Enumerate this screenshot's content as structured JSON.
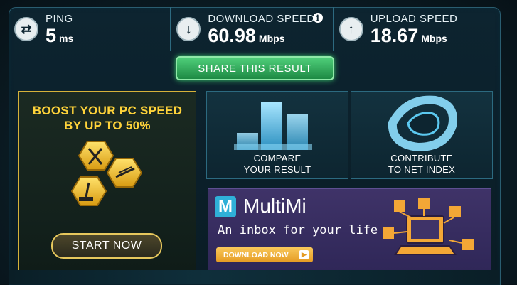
{
  "stats": {
    "ping": {
      "label": "PING",
      "value": "5",
      "unit": "ms",
      "icon": "ping-arrows-icon"
    },
    "download": {
      "label": "DOWNLOAD SPEED",
      "value": "60.98",
      "unit": "Mbps",
      "icon": "download-arrow-icon",
      "info": "i"
    },
    "upload": {
      "label": "UPLOAD SPEED",
      "value": "18.67",
      "unit": "Mbps",
      "icon": "upload-arrow-icon"
    }
  },
  "share_label": "SHARE THIS RESULT",
  "boost": {
    "title_line1": "BOOST YOUR PC SPEED",
    "title_line2": "BY UP TO 50%",
    "cta": "START NOW"
  },
  "compare": {
    "line1": "COMPARE",
    "line2": "YOUR RESULT"
  },
  "contribute": {
    "line1": "CONTRIBUTE",
    "line2": "TO NET INDEX"
  },
  "ad": {
    "logo_letter": "M",
    "brand": "MultiMi",
    "tagline": "An inbox for your life",
    "cta": "DOWNLOAD NOW"
  },
  "colors": {
    "accent_green": "#38c46a",
    "boost_yellow": "#ffd33a",
    "ad_purple": "#3f3368",
    "ad_orange": "#e59b22"
  }
}
